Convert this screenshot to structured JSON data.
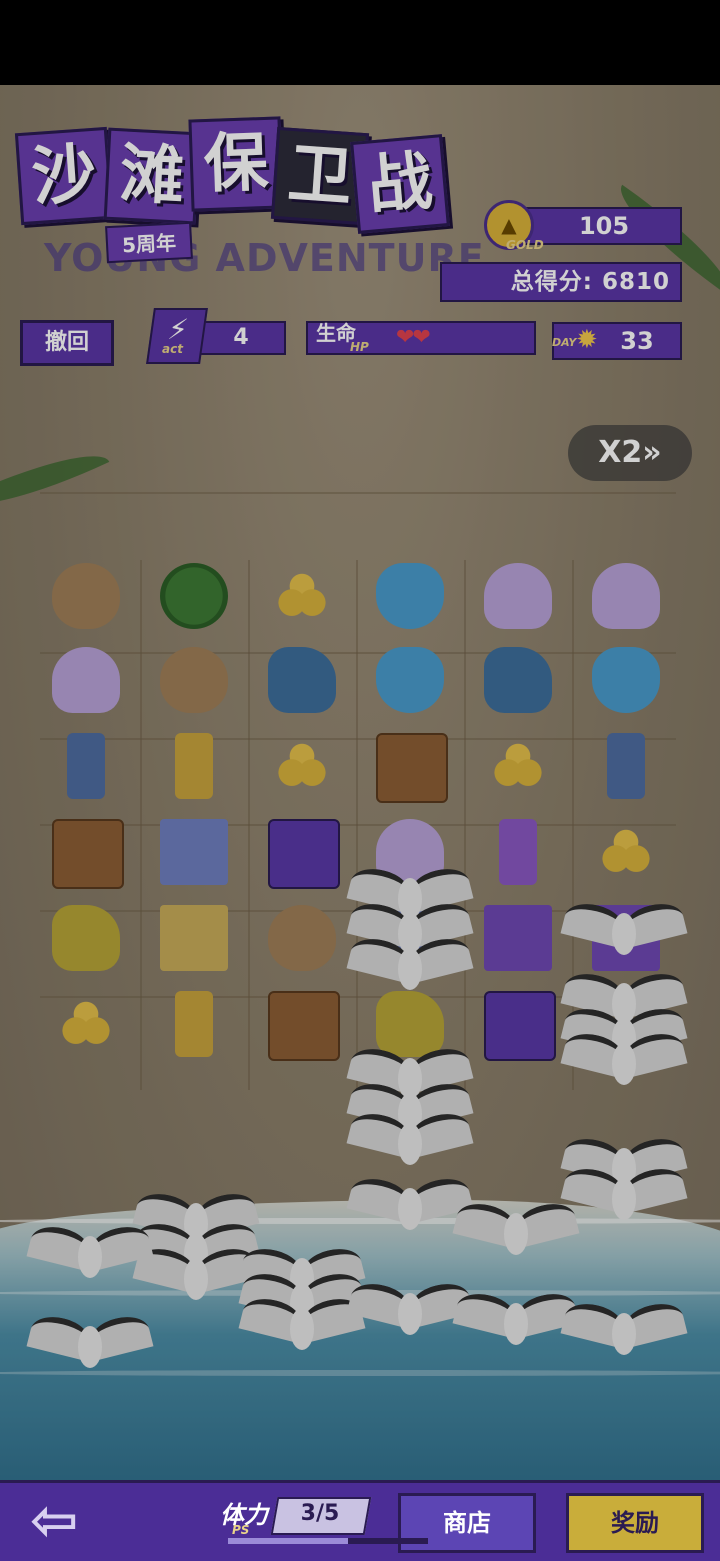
{
  "title": {
    "chars": [
      "沙",
      "滩",
      "保",
      "卫",
      "战"
    ],
    "anniversary": "5周年",
    "subtitle": "YOUNG ADVENTURE"
  },
  "stats": {
    "gold_value": "105",
    "gold_tag": "GOLD",
    "score_label": "总得分:",
    "score_value": "6810",
    "score_text": "总得分: 6810",
    "undo_label": "撤回",
    "act_value": "4",
    "act_tag": "act",
    "hp_label": "生命",
    "hp_tag": "HP",
    "hp_hearts": "❤❤",
    "hp_count": 2,
    "day_tag": "DAY",
    "day_value": "33"
  },
  "speed": {
    "label": "X2»"
  },
  "board": {
    "rows": [
      [
        "sand-shovel",
        "watermelon",
        "coins",
        "flip-flops",
        "shell",
        "shell"
      ],
      [
        "shell",
        "sand-shovel",
        "blue-cannon",
        "flip-flops",
        "blue-cannon",
        "flip-flops"
      ],
      [
        "blue-tower",
        "gold-tower",
        "coins",
        "brown-card",
        "coins",
        "blue-tower"
      ],
      [
        "brown-card",
        "blue-wall",
        "purple-card",
        "shell",
        "purple-tower",
        "coins"
      ],
      [
        "gold-cannon",
        "gold-wall",
        "sand-shovel",
        "blue-wall",
        "purple-wall",
        "purple-wall"
      ],
      [
        "coins",
        "gold-tower",
        "brown-card",
        "gold-cannon",
        "purple-card",
        "empty"
      ]
    ]
  },
  "bottom": {
    "back_icon": "arrow-left-icon",
    "ps_label": "体力",
    "ps_tag": "PS",
    "ps_value": "3/5",
    "ps_fraction": 0.6,
    "shop_label": "商店",
    "reward_label": "奖励"
  },
  "colors": {
    "primary_purple": "#5b36a6",
    "dark_outline": "#2a1b52",
    "gold": "#c9ad3a"
  }
}
